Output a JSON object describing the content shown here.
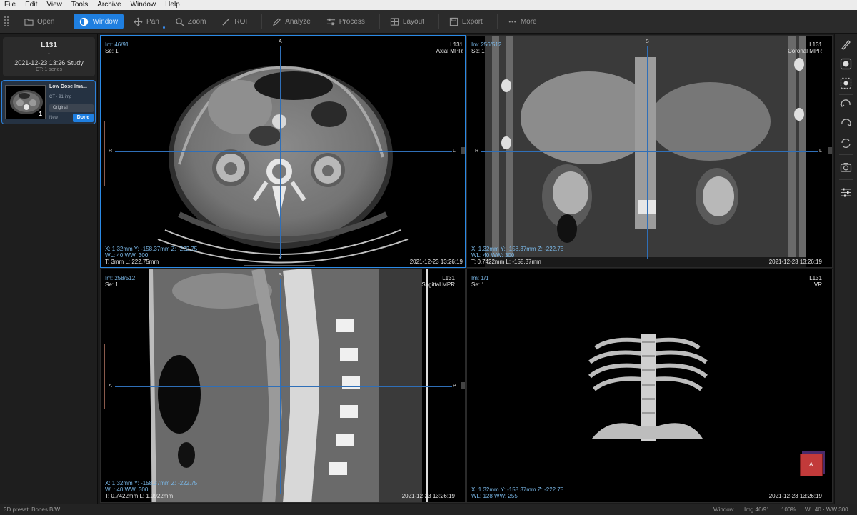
{
  "menu": [
    "File",
    "Edit",
    "View",
    "Tools",
    "Archive",
    "Window",
    "Help"
  ],
  "toolbar": {
    "open": "Open",
    "window": "Window",
    "pan": "Pan",
    "zoom": "Zoom",
    "roi": "ROI",
    "analyze": "Analyze",
    "process": "Process",
    "layout": "Layout",
    "export": "Export",
    "more": "More"
  },
  "study": {
    "patient_id": "L131",
    "dash": "-",
    "datetime": "2021-12-23 13:26  Study",
    "summary": "CT: 1 series"
  },
  "series": {
    "name": "Low Dose Ima...",
    "meta": "CT · 91 img",
    "badge": "Original",
    "status": "New",
    "done": "Done",
    "thumb_count": "1"
  },
  "viewports": {
    "axial": {
      "im": "Im: 46/91",
      "se": "Se: 1",
      "pid": "L131",
      "plane": "Axial MPR",
      "coords": "X: 1.32mm Y: -158.37mm Z: -222.75",
      "wl": "WL: 40 WW: 300",
      "tl": "T: 3mm L: 222.75mm",
      "date": "2021-12-23 13:26:19",
      "top": "A",
      "bottom": "P",
      "left": "R",
      "right": "L"
    },
    "coronal": {
      "im": "Im: 256/512",
      "se": "Se: 1",
      "pid": "L131",
      "plane": "Coronal MPR",
      "coords": "X: 1.32mm Y: -158.37mm Z: -222.75",
      "wl": "WL: 40 WW: 300",
      "tl": "T: 0.7422mm L: -158.37mm",
      "date": "2021-12-23 13:26:19",
      "top": "S",
      "left": "R",
      "right": "L"
    },
    "sagittal": {
      "im": "Im: 258/512",
      "se": "Se: 1",
      "pid": "L131",
      "plane": "Sagittal MPR",
      "coords": "X: 1.32mm Y: -158.37mm Z: -222.75",
      "wl": "WL: 40 WW: 300",
      "tl": "T: 0.7422mm L: 1.0922mm",
      "date": "2021-12-23 13:26:19",
      "top": "S",
      "left": "A",
      "right": "P"
    },
    "vr": {
      "im": "Im: 1/1",
      "se": "Se: 1",
      "pid": "L131",
      "plane": "VR",
      "coords": "X: 1.32mm Y: -158.37mm Z: -222.75",
      "wl": "WL: 128 WW: 255",
      "date": "2021-12-23 13:26:19",
      "cube": "A"
    }
  },
  "status": {
    "left": "3D preset: Bones B/W",
    "tool": "Window",
    "img": "Img 46/91",
    "zoom": "100%",
    "wlww": "WL 40 · WW 300"
  },
  "colors": {
    "accent": "#1f7fe0",
    "crosshair": "#2f6fb8",
    "overlay_cyan": "#7ab8e8",
    "cube_red": "#c23a3a"
  },
  "right_tools": [
    "brush-icon",
    "circle-fill-icon",
    "circle-dashed-icon",
    "rotate-left-icon",
    "rotate-right-icon",
    "reset-icon",
    "camera-icon",
    "sliders-icon"
  ]
}
